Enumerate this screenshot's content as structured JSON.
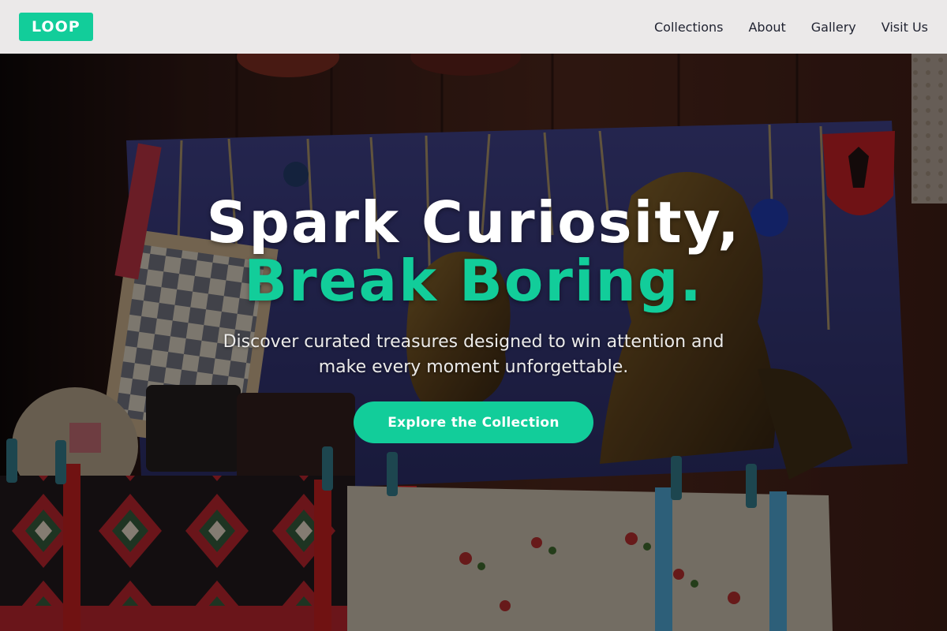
{
  "brand": {
    "logo_text": "LOOP",
    "accent_color": "#12cd9a"
  },
  "nav": {
    "links": [
      {
        "label": "Collections"
      },
      {
        "label": "About"
      },
      {
        "label": "Gallery"
      },
      {
        "label": "Visit Us"
      }
    ]
  },
  "hero": {
    "headline_line1": "Spark Curiosity,",
    "headline_line2": "Break Boring.",
    "subtext": "Discover curated treasures designed to win attention and make every moment unforgettable.",
    "cta_label": "Explore the Collection",
    "background_image": "market stall with hanging souvenirs, chessboard, bronze busts and embroidered textiles"
  }
}
